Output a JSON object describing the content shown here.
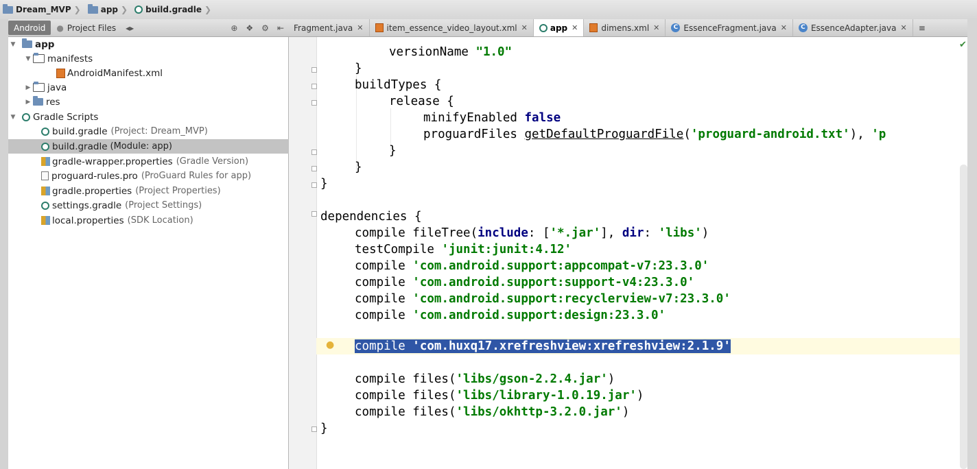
{
  "breadcrumb": [
    "Dream_MVP",
    "app",
    "build.gradle"
  ],
  "toolbar": {
    "android": "Android",
    "project_files": "Project Files"
  },
  "tabs": [
    {
      "label": "Fragment.java",
      "icon": "c",
      "active": false
    },
    {
      "label": "item_essence_video_layout.xml",
      "icon": "xml",
      "active": false
    },
    {
      "label": "app",
      "icon": "gradle",
      "active": true
    },
    {
      "label": "dimens.xml",
      "icon": "xml",
      "active": false
    },
    {
      "label": "EssenceFragment.java",
      "icon": "c",
      "active": false
    },
    {
      "label": "EssenceAdapter.java",
      "icon": "c",
      "active": false
    }
  ],
  "tree": {
    "app": "app",
    "manifests": "manifests",
    "manifest_file": "AndroidManifest.xml",
    "java": "java",
    "res": "res",
    "gradle_scripts": "Gradle Scripts",
    "items": [
      {
        "name": "build.gradle",
        "hint": "(Project: Dream_MVP)",
        "icon": "gradle"
      },
      {
        "name": "build.gradle",
        "hint": "(Module: app)",
        "icon": "gradle"
      },
      {
        "name": "gradle-wrapper.properties",
        "hint": "(Gradle Version)",
        "icon": "props"
      },
      {
        "name": "proguard-rules.pro",
        "hint": "(ProGuard Rules for app)",
        "icon": "file"
      },
      {
        "name": "gradle.properties",
        "hint": "(Project Properties)",
        "icon": "props"
      },
      {
        "name": "settings.gradle",
        "hint": "(Project Settings)",
        "icon": "gradle"
      },
      {
        "name": "local.properties",
        "hint": "(SDK Location)",
        "icon": "props"
      }
    ]
  },
  "code": {
    "l1a": "versionName ",
    "l1b": "\"1.0\"",
    "l2": "}",
    "l3": "buildTypes {",
    "l4": "release {",
    "l5a": "minifyEnabled ",
    "l5b": "false",
    "l6a": "proguardFiles ",
    "l6b": "getDefaultProguardFile",
    "l6c": "(",
    "l6d": "'proguard-android.txt'",
    "l6e": "), ",
    "l6f": "'p",
    "l7": "}",
    "l8": "}",
    "l9": "}",
    "l10": "dependencies {",
    "l11a": "compile fileTree(",
    "l11b": "include",
    "l11c": ": [",
    "l11d": "'*.jar'",
    "l11e": "], ",
    "l11f": "dir",
    "l11g": ": ",
    "l11h": "'libs'",
    "l11i": ")",
    "l12a": "testCompile ",
    "l12b": "'junit:junit:4.12'",
    "l13a": "compile ",
    "l13b": "'com.android.support:appcompat-v7:23.3.0'",
    "l14a": "compile ",
    "l14b": "'com.android.support:support-v4:23.3.0'",
    "l15a": "compile ",
    "l15b": "'com.android.support:recyclerview-v7:23.3.0'",
    "l16a": "compile ",
    "l16b": "'com.android.support:design:23.3.0'",
    "l17a": "compile ",
    "l17b": "'com.huxq17.xrefreshview:xrefreshview:2.1.9'",
    "l18a": "compile files(",
    "l18b": "'libs/gson-2.2.4.jar'",
    "l18c": ")",
    "l19a": "compile files(",
    "l19b": "'libs/library-1.0.19.jar'",
    "l19c": ")",
    "l20a": "compile files(",
    "l20b": "'libs/okhttp-3.2.0.jar'",
    "l20c": ")",
    "l21": "}"
  }
}
